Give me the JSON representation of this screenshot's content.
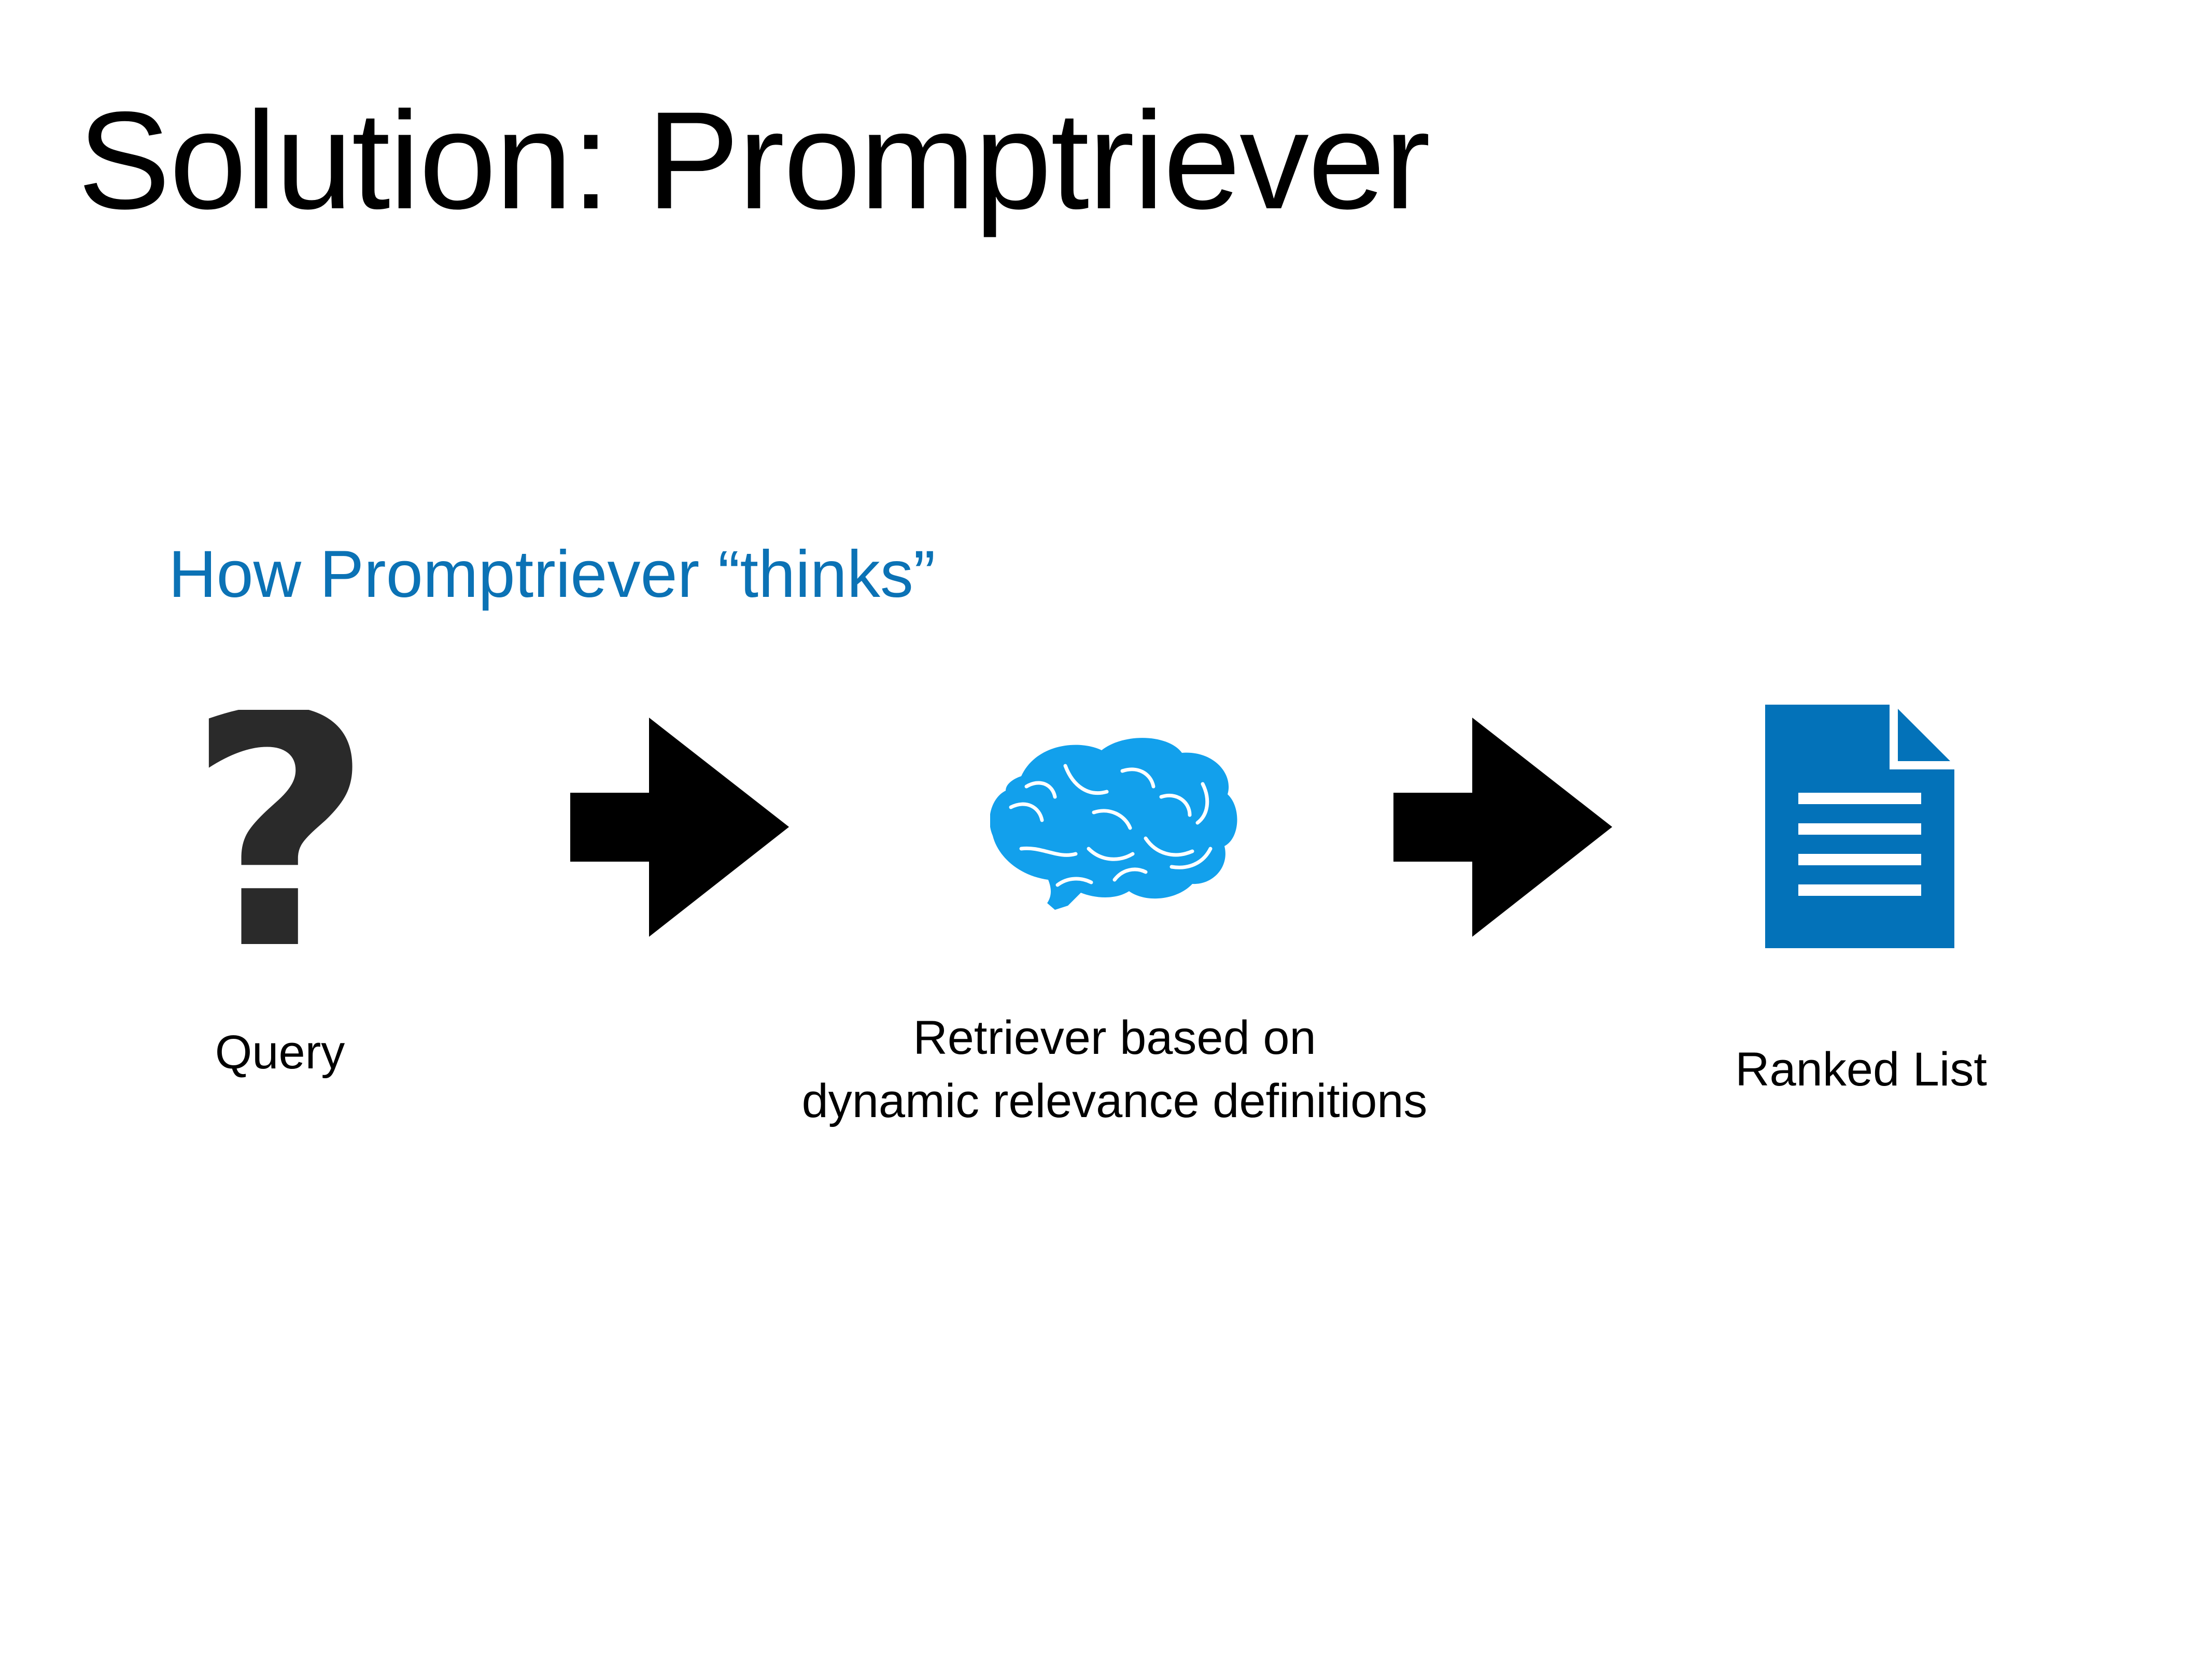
{
  "slide": {
    "title": "Solution: Promptriever",
    "subtitle": "How Promptriever “thinks”"
  },
  "flow": {
    "query": {
      "icon": "question-mark-icon",
      "label": "Query"
    },
    "retriever": {
      "icon": "brain-icon",
      "label_line1": "Retriever based on",
      "label_line2": "dynamic relevance definitions"
    },
    "ranked_list": {
      "icon": "document-icon",
      "label": "Ranked List"
    },
    "arrow_icon": "right-arrow-icon"
  },
  "colors": {
    "title": "#000000",
    "subtitle": "#0B72B5",
    "question_mark": "#2A2A2A",
    "arrow": "#000000",
    "brain": "#12A0EC",
    "document": "#0372B9"
  }
}
